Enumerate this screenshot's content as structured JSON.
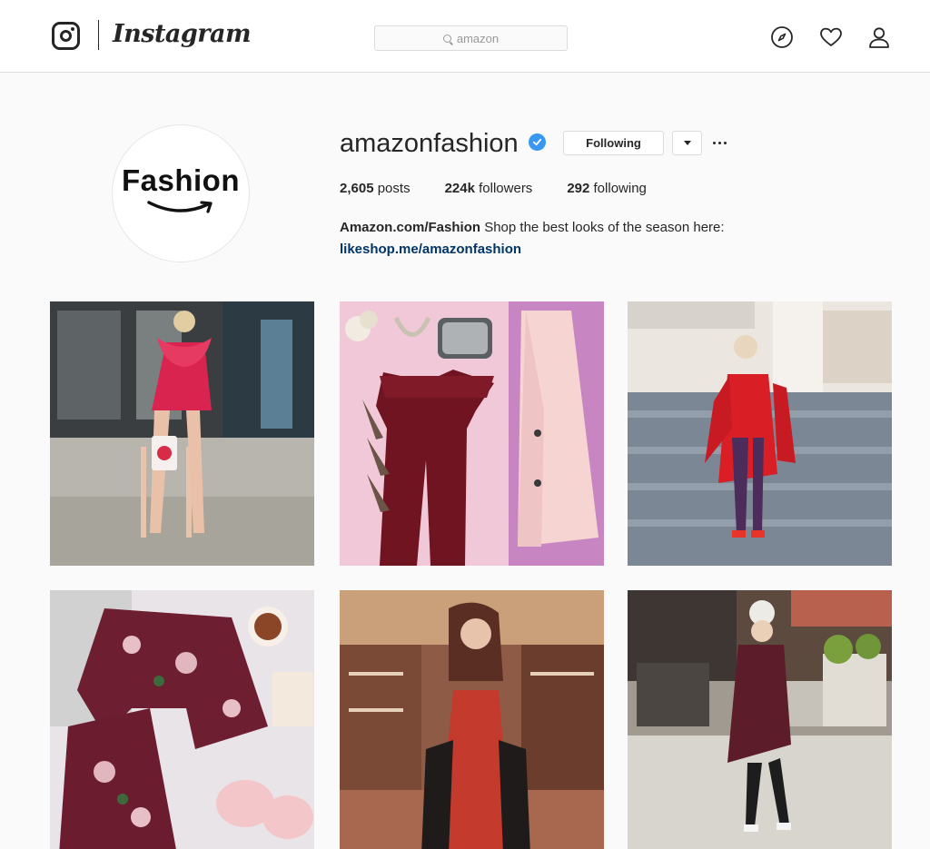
{
  "app": {
    "wordmark": "Instagram"
  },
  "search": {
    "value": "amazon"
  },
  "nav_icons": [
    "compass-icon",
    "heart-icon",
    "person-icon"
  ],
  "profile": {
    "avatar_text": "Fashion",
    "username": "amazonfashion",
    "verified": true,
    "follow_button_label": "Following",
    "stats": {
      "posts_count": "2,605",
      "posts_label": "posts",
      "followers_count": "224k",
      "followers_label": "followers",
      "following_count": "292",
      "following_label": "following"
    },
    "bio": {
      "name": "Amazon.com/Fashion",
      "text": "Shop the best looks of the season here:",
      "link": "likeshop.me/amazonfashion"
    }
  },
  "posts": [
    {
      "subject": "woman in pink ruffle dress on street"
    },
    {
      "subject": "flat lay burgundy jumpsuit and pink coat"
    },
    {
      "subject": "woman in red coat on stairs"
    },
    {
      "subject": "floral pajama set with slippers"
    },
    {
      "subject": "woman in red slip dress at bar"
    },
    {
      "subject": "woman in burgundy coat walking on sidewalk"
    }
  ],
  "colors": {
    "accent_blue": "#3897f0",
    "link": "#003569",
    "border": "#dbdbdb",
    "background": "#fafafa"
  }
}
